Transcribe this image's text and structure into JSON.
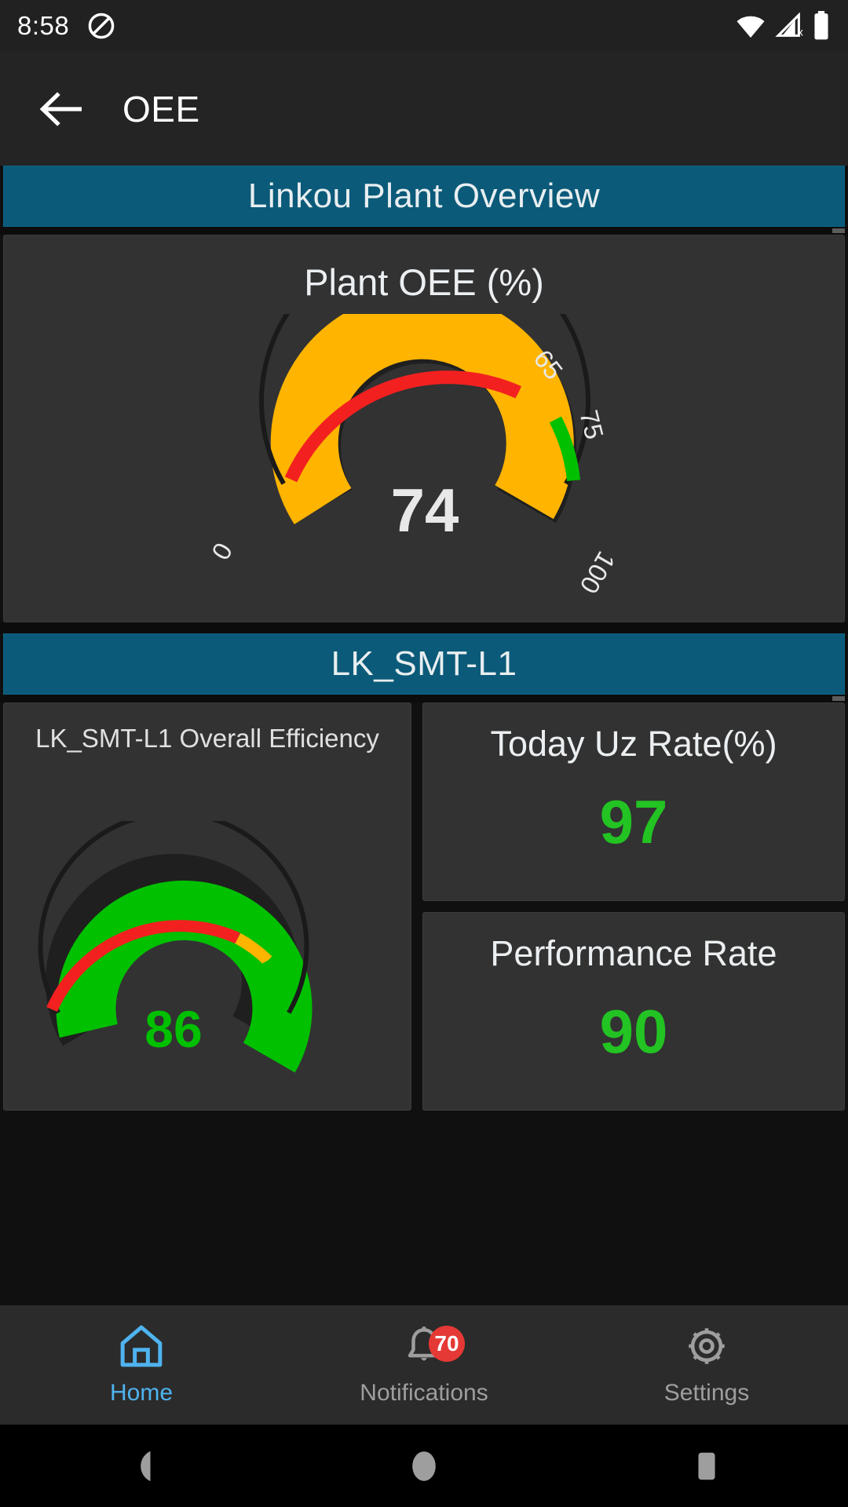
{
  "status_bar": {
    "time": "8:58",
    "icons": [
      "dnd-icon",
      "wifi-icon",
      "cellular-off-icon",
      "battery-icon"
    ]
  },
  "app_bar": {
    "back_icon": "back-arrow-icon",
    "title": "OEE"
  },
  "sections": [
    {
      "banner": "Linkou Plant Overview",
      "card": {
        "title": "Plant OEE (%)",
        "type": "gauge"
      }
    },
    {
      "banner": "LK_SMT-L1",
      "gauge_card_title": "LK_SMT-L1 Overall Efficiency",
      "kpis": [
        {
          "title": "Today Uz Rate(%)",
          "value": "97",
          "color": "#22c322"
        },
        {
          "title": "Performance Rate",
          "value": "90",
          "color": "#22c322"
        }
      ]
    }
  ],
  "bottom_nav": [
    {
      "label": "Home",
      "icon": "home-icon",
      "active": true,
      "badge": null
    },
    {
      "label": "Notifications",
      "icon": "bell-icon",
      "active": false,
      "badge": "70"
    },
    {
      "label": "Settings",
      "icon": "gear-icon",
      "active": false,
      "badge": null
    }
  ],
  "android_nav": [
    "back-triangle-icon",
    "home-circle-icon",
    "recents-square-icon"
  ],
  "colors": {
    "banner": "#0b5a79",
    "card": "#323232",
    "page": "#101010",
    "red": "#f32020",
    "orange": "#ffb400",
    "green": "#00c000",
    "track": "#262626",
    "accent": "#4fb3ef",
    "badge": "#e53935"
  },
  "chart_data": [
    {
      "type": "gauge",
      "title": "Plant OEE (%)",
      "value": 74,
      "value_label": "74",
      "min": 0,
      "max": 100,
      "tick_labels": [
        "0",
        "65",
        "75",
        "100"
      ],
      "ticks": [
        0,
        65,
        75,
        100
      ],
      "value_arc_color": "#ffb400",
      "bands": [
        {
          "from": 0,
          "to": 65,
          "color": "#f32020",
          "name": "red"
        },
        {
          "from": 65,
          "to": 75,
          "color": "#ffb400",
          "name": "orange"
        },
        {
          "from": 75,
          "to": 100,
          "color": "#00c000",
          "name": "green"
        }
      ],
      "start_angle": 210,
      "end_angle": -30,
      "ylabel": "",
      "xlabel": ""
    },
    {
      "type": "gauge",
      "title": "LK_SMT-L1 Overall Efficiency",
      "value": 86,
      "value_label": "86",
      "min": 0,
      "max": 100,
      "tick_labels": [],
      "ticks": [
        0,
        65,
        75,
        100
      ],
      "value_arc_color": "#00c000",
      "bands": [
        {
          "from": 0,
          "to": 65,
          "color": "#f32020",
          "name": "red"
        },
        {
          "from": 65,
          "to": 75,
          "color": "#ffb400",
          "name": "orange"
        },
        {
          "from": 75,
          "to": 100,
          "color": "#00c000",
          "name": "green"
        }
      ],
      "start_angle": 210,
      "end_angle": -30,
      "ylabel": "",
      "xlabel": ""
    },
    {
      "type": "kpi",
      "title": "Today Uz Rate(%)",
      "value": 97,
      "value_label": "97"
    },
    {
      "type": "kpi",
      "title": "Performance Rate",
      "value": 90,
      "value_label": "90"
    }
  ]
}
